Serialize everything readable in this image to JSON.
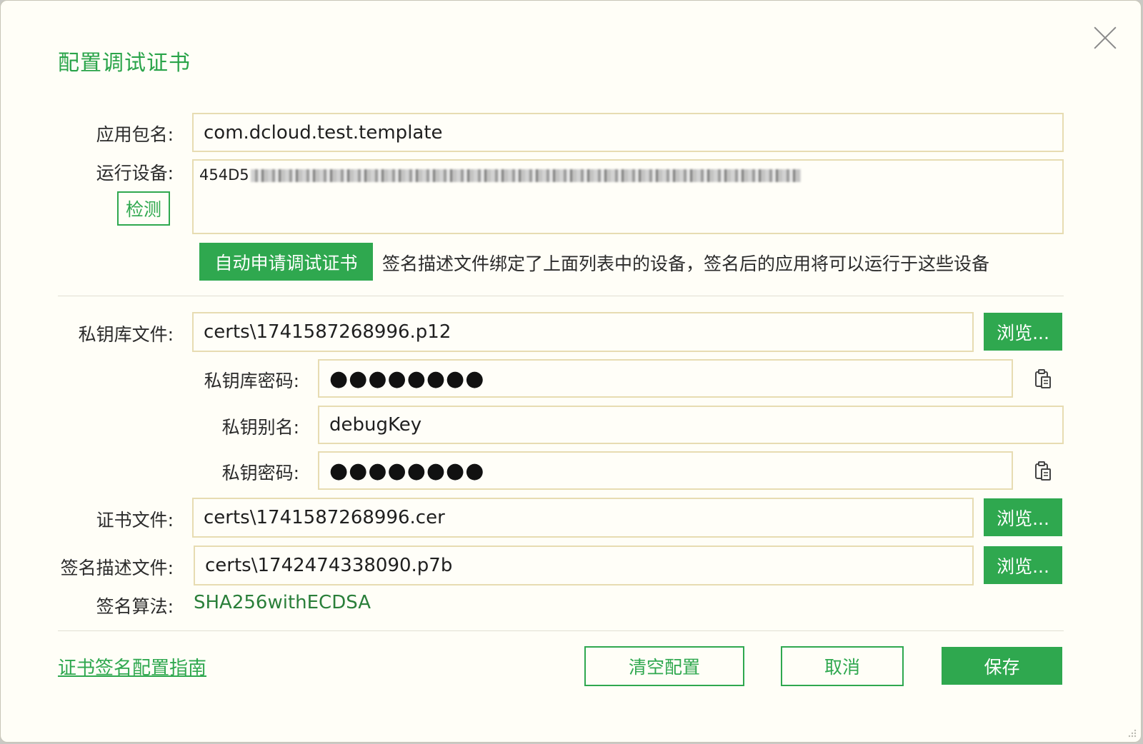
{
  "dialog": {
    "title": "配置调试证书"
  },
  "form": {
    "package_label": "应用包名:",
    "package_value": "com.dcloud.test.template",
    "device_label": "运行设备:",
    "detect_button": "检测",
    "device_value_prefix": "454D5",
    "auto_apply_button": "自动申请调试证书",
    "auto_apply_hint": "签名描述文件绑定了上面列表中的设备，签名后的应用将可以运行于这些设备",
    "keystore_label": "私钥库文件:",
    "keystore_value": "certs\\1741587268996.p12",
    "browse_label": "浏览...",
    "keystore_password_label": "私钥库密码:",
    "keystore_password_value": "●●●●●●●●",
    "alias_label": "私钥别名:",
    "alias_value": "debugKey",
    "key_password_label": "私钥密码:",
    "key_password_value": "●●●●●●●●",
    "cert_label": "证书文件:",
    "cert_value": "certs\\1741587268996.cer",
    "profile_label": "签名描述文件:",
    "profile_value": "certs\\1742474338090.p7b",
    "algorithm_label": "签名算法:",
    "algorithm_value": "SHA256withECDSA"
  },
  "footer": {
    "guide_link": "证书签名配置指南",
    "clear_button": "清空配置",
    "cancel_button": "取消",
    "save_button": "保存"
  },
  "icons": {
    "close": "close-icon",
    "paste": "clipboard-icon"
  },
  "colors": {
    "accent": "#2fa84f",
    "field_border": "#e7dcb2",
    "background": "#fffef7"
  }
}
